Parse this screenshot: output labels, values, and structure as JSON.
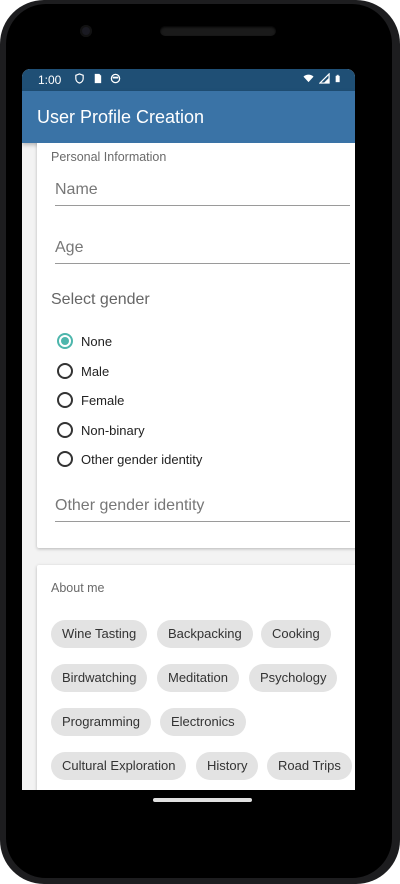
{
  "status_bar": {
    "time": "1:00",
    "icons_left": [
      "shield-icon",
      "sim-card-icon",
      "circle-icon"
    ],
    "icons_right": [
      "wifi-icon",
      "signal-icon",
      "battery-icon"
    ]
  },
  "app_bar": {
    "title": "User Profile Creation"
  },
  "personal_card": {
    "title": "Personal Information",
    "name_placeholder": "Name",
    "age_placeholder": "Age",
    "select_gender_label": "Select gender",
    "gender_options": [
      "None",
      "Male",
      "Female",
      "Non-binary",
      "Other gender identity"
    ],
    "selected_gender": "None",
    "other_gender_placeholder": "Other gender identity"
  },
  "about_card": {
    "title": "About me",
    "chips": [
      "Wine Tasting",
      "Backpacking",
      "Cooking",
      "Birdwatching",
      "Meditation",
      "Psychology",
      "Programming",
      "Electronics",
      "Cultural Exploration",
      "History",
      "Road Trips"
    ]
  },
  "colors": {
    "status_bar": "#1f4f75",
    "app_bar": "#3a73a6",
    "radio_accent": "#4db6ac",
    "chip_bg": "#e3e3e3"
  }
}
